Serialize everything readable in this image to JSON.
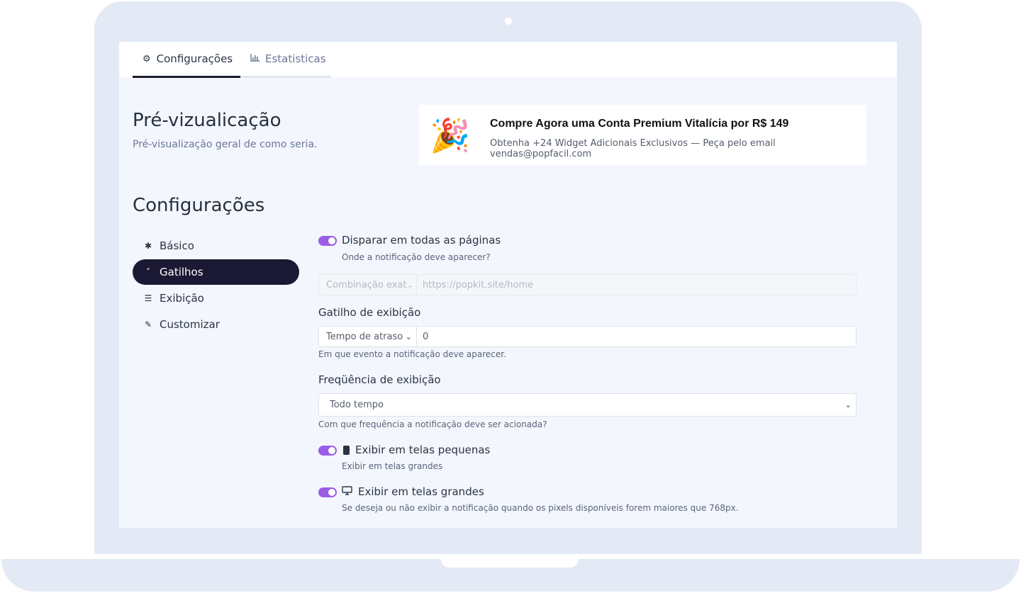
{
  "tabs": [
    {
      "label": "Configurações",
      "icon": "gears-icon"
    },
    {
      "label": "Estatisticas",
      "icon": "bar-chart-icon"
    }
  ],
  "preview": {
    "heading": "Pré-vizualicação",
    "subheading": "Pré-visualização geral de como seria.",
    "card_icon": "party-popper-icon",
    "card_title": "Compre Agora uma Conta Premium Vitalícia por R$ 149",
    "card_desc": "Obtenha +24 Widget Adicionais Exclusivos — Peça pelo email vendas@popfacil.com"
  },
  "config": {
    "heading": "Configurações"
  },
  "sidebar": {
    "items": [
      {
        "label": "Básico",
        "icon": "gear-icon"
      },
      {
        "label": "Gatilhos",
        "icon": "chevron-up-icon"
      },
      {
        "label": "Exibição",
        "icon": "sliders-icon"
      },
      {
        "label": "Customizar",
        "icon": "brush-icon"
      }
    ]
  },
  "form": {
    "all_pages": {
      "label": "Disparar em todas as páginas",
      "help": "Onde a notificação deve aparecer?",
      "enabled": true
    },
    "url_rule": {
      "match_value": "Combinação exat",
      "placeholder": "https://popkit.site/home"
    },
    "trigger": {
      "label": "Gatilho de exibição",
      "select_value": "Tempo de atraso",
      "input_value": "0",
      "help": "Em que evento a notificação deve aparecer."
    },
    "frequency": {
      "label": "Freqüência de exibição",
      "select_value": "Todo tempo",
      "help": "Com que frequência a notificação deve ser acionada?"
    },
    "small_screens": {
      "label": "Exibir em telas pequenas",
      "help": "Exibir em telas grandes",
      "icon": "mobile-icon",
      "enabled": true
    },
    "large_screens": {
      "label": "Exibir em telas grandes",
      "help": "Se deseja ou não exibir a notificação quando os pixels disponíveis forem maiores que 768px.",
      "icon": "desktop-icon",
      "enabled": true
    }
  },
  "colors": {
    "accent": "#9b5de5",
    "active_nav": "#1b1833",
    "frame": "#e3eaf5"
  }
}
